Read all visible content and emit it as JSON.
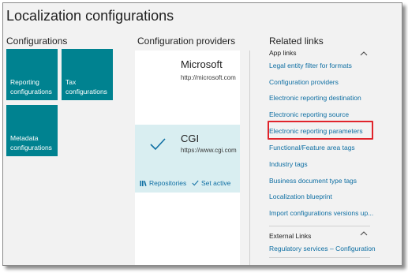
{
  "page": {
    "title": "Localization configurations"
  },
  "configurations": {
    "heading": "Configurations",
    "tiles": [
      {
        "line1": "Reporting",
        "line2": "configurations"
      },
      {
        "line1": "Tax",
        "line2": "configurations"
      },
      {
        "line1": "Metadata",
        "line2": "configurations"
      }
    ],
    "tile_color": "#008290"
  },
  "providers": {
    "heading": "Configuration providers",
    "items": [
      {
        "name": "Microsoft",
        "url": "http://microsoft.com",
        "active": false
      },
      {
        "name": "CGI",
        "url": "https://www.cgi.com",
        "active": true,
        "actions": {
          "repositories": "Repositories",
          "set_active": "Set active"
        }
      }
    ],
    "selected_color": "#d9eef1"
  },
  "related": {
    "heading": "Related links",
    "app_links": {
      "label": "App links",
      "items": [
        "Legal entity filter for formats",
        "Configuration providers",
        "Electronic reporting destination",
        "Electronic reporting source",
        "Electronic reporting parameters",
        "Functional/Feature area tags",
        "Industry tags",
        "Business document type tags",
        "Localization blueprint",
        "Import configurations versions up..."
      ],
      "highlighted_item": "Electronic reporting parameters"
    },
    "external_links": {
      "label": "External Links",
      "items": [
        "Regulatory services – Configuration"
      ]
    },
    "link_color": "#0f6fa3",
    "highlight_color": "#e0242b"
  }
}
